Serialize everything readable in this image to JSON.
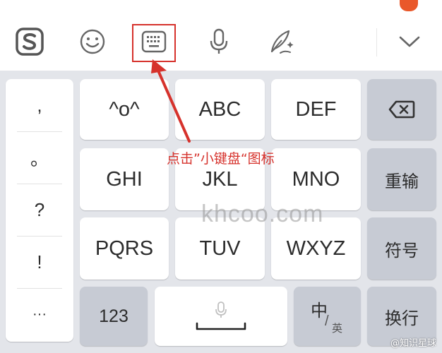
{
  "toolbar": {
    "items": [
      {
        "name": "sogou-logo-icon",
        "interactable": true
      },
      {
        "name": "emoji-icon",
        "interactable": true
      },
      {
        "name": "keyboard-icon",
        "interactable": true
      },
      {
        "name": "microphone-icon",
        "interactable": true
      },
      {
        "name": "handwriting-icon",
        "interactable": true
      },
      {
        "name": "chevron-down-icon",
        "interactable": true
      }
    ],
    "sogou_letter": "S"
  },
  "accent_color": "#d6322c",
  "annotation": {
    "text": "点击”小键盘“图标"
  },
  "keyboard": {
    "symbols": [
      ",",
      "。",
      "?",
      "!",
      "···"
    ],
    "keys": {
      "face": "^o^",
      "abc": "ABC",
      "def": "DEF",
      "ghi": "GHI",
      "jkl": "JKL",
      "mno": "MNO",
      "pqrs": "PQRS",
      "tuv": "TUV",
      "wxyz": "WXYZ",
      "retype": "重输",
      "symbols": "符号",
      "num": "123",
      "lang_main": "中",
      "lang_sub": "英",
      "enter": "换行"
    }
  },
  "watermark": "khcoo.com",
  "source_badge": "@知识星球"
}
